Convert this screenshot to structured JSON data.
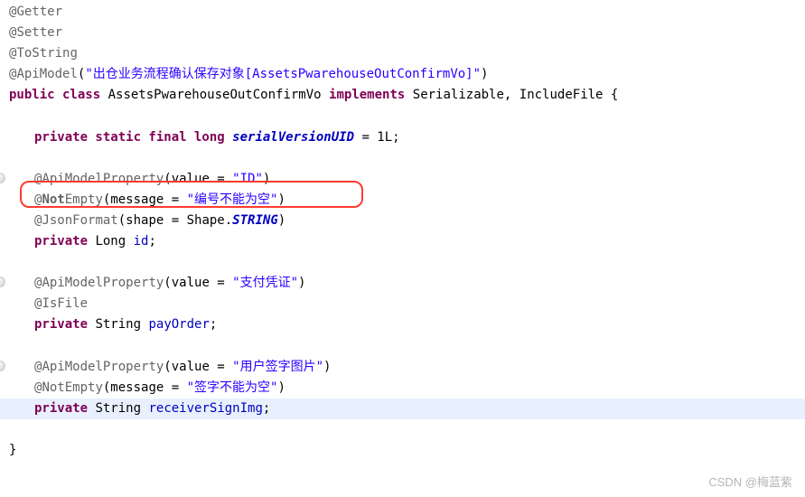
{
  "lines": {
    "l1": {
      "at": "@",
      "anno": "Getter"
    },
    "l2": {
      "at": "@",
      "anno": "Setter"
    },
    "l3": {
      "at": "@",
      "anno": "ToString"
    },
    "l4": {
      "at": "@",
      "anno": "ApiModel",
      "lparen": "(",
      "str": "\"出仓业务流程确认保存对象[AssetsPwarehouseOutConfirmVo]\"",
      "rparen": ")"
    },
    "l5": {
      "kw1": "public class",
      "sp1": " ",
      "cls": "AssetsPwarehouseOutConfirmVo ",
      "kw2": "implements",
      "sp2": " ",
      "impl": "Serializable, IncludeFile {"
    },
    "l6": {
      "kw": "private static final long",
      "sp": " ",
      "field": "serialVersionUID",
      "rest": " = 1L;"
    },
    "l7": {
      "at": "@",
      "anno": "ApiModelProperty",
      "mid": "(value = ",
      "str": "\"ID\"",
      "rparen": ")"
    },
    "l8": {
      "at": "@",
      "anno": "Not",
      "anno2": "Empty",
      "mid": "(message = ",
      "str": "\"编号不能为空\"",
      "rparen": ")"
    },
    "l9": {
      "at": "@",
      "anno": "JsonFormat",
      "mid": "(shape = Shape.",
      "enum": "STRING",
      "rparen": ")"
    },
    "l10": {
      "kw": "private",
      "sp": " ",
      "type": "Long ",
      "field": "id",
      "semi": ";"
    },
    "l11": {
      "at": "@",
      "anno": "ApiModelProperty",
      "mid": "(value = ",
      "str": "\"支付凭证\"",
      "rparen": ")"
    },
    "l12": {
      "at": "@",
      "anno": "IsFile"
    },
    "l13": {
      "kw": "private",
      "sp": " ",
      "type": "String ",
      "field": "payOrder",
      "semi": ";"
    },
    "l14": {
      "at": "@",
      "anno": "ApiModelProperty",
      "mid": "(value = ",
      "str": "\"用户签字图片\"",
      "rparen": ")"
    },
    "l15": {
      "at": "@",
      "anno": "NotEmpty",
      "mid": "(message = ",
      "str": "\"签字不能为空\"",
      "rparen": ")"
    },
    "l16": {
      "kw": "private",
      "sp": " ",
      "type": "String ",
      "field": "receiverSignImg",
      "semi": ";"
    },
    "l17": {
      "brace": "}"
    }
  },
  "watermark": "CSDN @梅蓝紫"
}
